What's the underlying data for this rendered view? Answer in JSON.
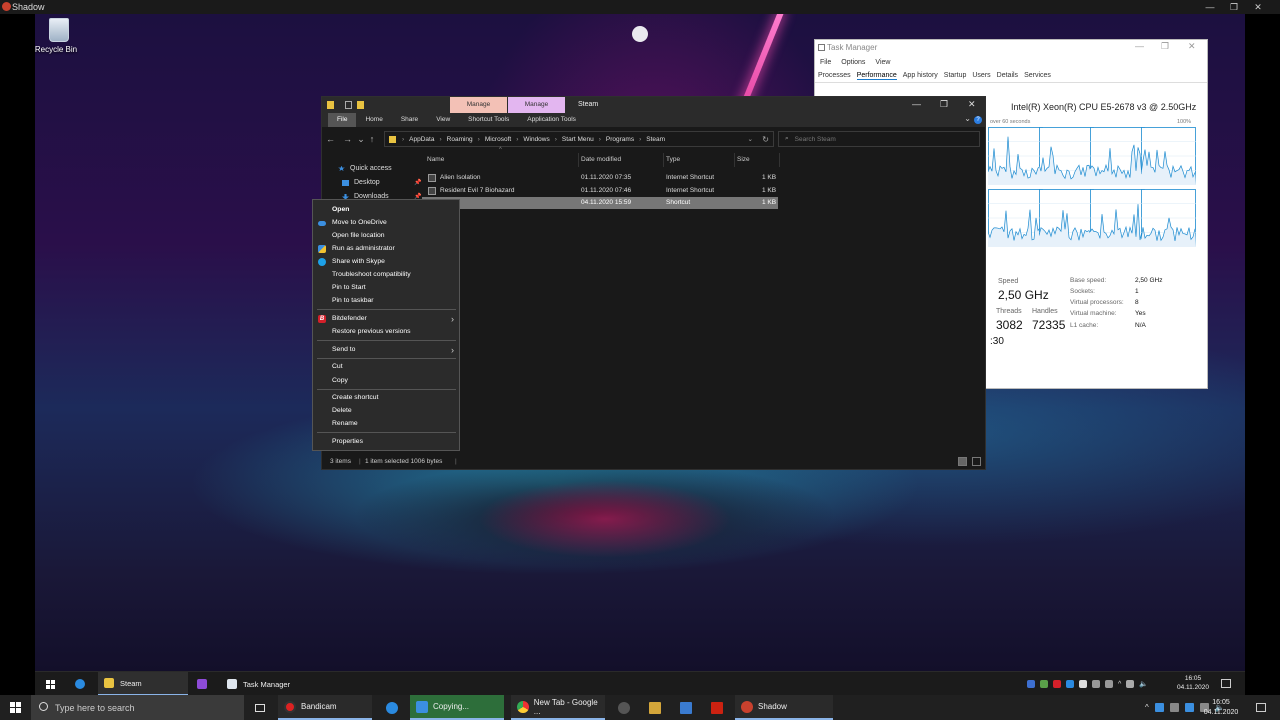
{
  "outer_window": {
    "title": "Shadow",
    "minimize": "—",
    "restore": "❐",
    "close": "✕"
  },
  "desktop": {
    "recycle_bin_label": "Recycle Bin"
  },
  "task_manager": {
    "title": "Task Manager",
    "menu": [
      "File",
      "Options",
      "View"
    ],
    "tabs": [
      "Processes",
      "Performance",
      "App history",
      "Startup",
      "Users",
      "Details",
      "Services"
    ],
    "active_tab": "Performance",
    "cpu_name": "Intel(R) Xeon(R) CPU E5-2678 v3 @ 2.50GHz",
    "graph_caption": "over 60 seconds",
    "graph_max": "100%",
    "speed_label": "Speed",
    "speed_value": "2,50 GHz",
    "threads_label": "Threads",
    "threads_value": "3082",
    "handles_label": "Handles",
    "handles_value": "72335",
    "details": [
      {
        "key": "Base speed:",
        "value": "2,50 GHz"
      },
      {
        "key": "Sockets:",
        "value": "1"
      },
      {
        "key": "Virtual processors:",
        "value": "8"
      },
      {
        "key": "Virtual machine:",
        "value": "Yes"
      },
      {
        "key": "L1 cache:",
        "value": "N/A"
      }
    ],
    "uptime_partial": ":30"
  },
  "explorer": {
    "window_title": "Steam",
    "context_tabs": [
      "Manage",
      "Manage"
    ],
    "ribbon_tabs": [
      "File",
      "Home",
      "Share",
      "View",
      "Shortcut Tools",
      "Application Tools"
    ],
    "help": "?",
    "breadcrumb": [
      "AppData",
      "Roaming",
      "Microsoft",
      "Windows",
      "Start Menu",
      "Programs",
      "Steam"
    ],
    "search_placeholder": "Search Steam",
    "nav": [
      "Quick access",
      "Desktop",
      "Downloads"
    ],
    "columns": [
      "Name",
      "Date modified",
      "Type",
      "Size"
    ],
    "files": [
      {
        "name": "Alien Isolation",
        "date": "01.11.2020 07:35",
        "type": "Internet Shortcut",
        "size": "1 KB"
      },
      {
        "name": "Resident Evil 7 Biohazard",
        "date": "01.11.2020 07:46",
        "type": "Internet Shortcut",
        "size": "1 KB"
      },
      {
        "name": "",
        "date": "04.11.2020 15:59",
        "type": "Shortcut",
        "size": "1 KB"
      }
    ],
    "status": {
      "count": "3 items",
      "selected": "1 item selected  1006 bytes"
    }
  },
  "context_menu": {
    "items": [
      "Open",
      "Move to OneDrive",
      "Open file location",
      "Run as administrator",
      "Share with Skype",
      "Troubleshoot compatibility",
      "Pin to Start",
      "Pin to taskbar",
      "Bitdefender",
      "Restore previous versions",
      "Send to",
      "Cut",
      "Copy",
      "Create shortcut",
      "Delete",
      "Rename",
      "Properties"
    ],
    "bitdefender_icon_letter": "B"
  },
  "inner_taskbar": {
    "items": [
      "Steam",
      "Task Manager"
    ],
    "clock_time": "16:05",
    "clock_date": "04.11.2020"
  },
  "outer_taskbar": {
    "search_placeholder": "Type here to search",
    "apps": [
      "Bandicam",
      "Copying...",
      "New Tab - Google ...",
      "Shadow"
    ],
    "clock_time": "16:05",
    "clock_date": "04.11.2020"
  },
  "colors": {
    "accent": "#1979ca",
    "manage_tab_1": "#f3c1b6",
    "manage_tab_2": "#e3b6f0",
    "graph_line": "#1a8ad0",
    "graph_fill": "#e7f1fa"
  }
}
